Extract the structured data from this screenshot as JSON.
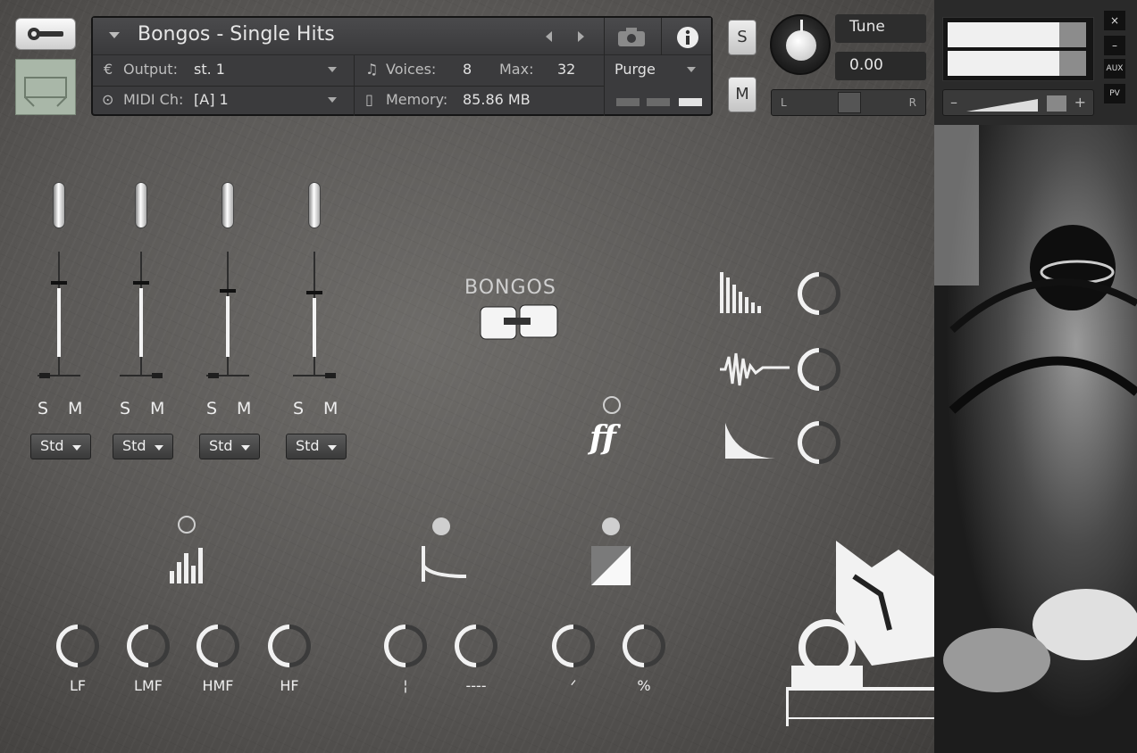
{
  "header": {
    "title": "Bongos - Single Hits",
    "output_label": "Output:",
    "output_value": "st. 1",
    "voices_label": "Voices:",
    "voices_value": "8",
    "max_label": "Max:",
    "max_value": "32",
    "midi_label": "MIDI Ch:",
    "midi_value": "[A]  1",
    "memory_label": "Memory:",
    "memory_value": "85.86 MB",
    "purge_label": "Purge"
  },
  "controls": {
    "solo": "S",
    "mute": "M",
    "tune_label": "Tune",
    "tune_value": "0.00",
    "pan_left": "L",
    "pan_right": "R"
  },
  "side": {
    "close": "×",
    "minimize": "–",
    "aux": "AUX",
    "pv": "PV",
    "vol_minus": "–",
    "vol_plus": "+"
  },
  "logo_text": "BONGOS",
  "dynamic_label": "ff",
  "mixer": {
    "channels": [
      {
        "level": 0.7,
        "solo": "S",
        "mute": "M",
        "mode": "Std"
      },
      {
        "level": 0.7,
        "solo": "S",
        "mute": "M",
        "mode": "Std"
      },
      {
        "level": 0.62,
        "solo": "S",
        "mute": "M",
        "mode": "Std"
      },
      {
        "level": 0.6,
        "solo": "S",
        "mute": "M",
        "mode": "Std"
      }
    ]
  },
  "eq": {
    "labels": [
      "LF",
      "LMF",
      "HMF",
      "HF"
    ]
  },
  "fx_labels": [
    "¦",
    "----",
    "ᐟ",
    "%"
  ]
}
